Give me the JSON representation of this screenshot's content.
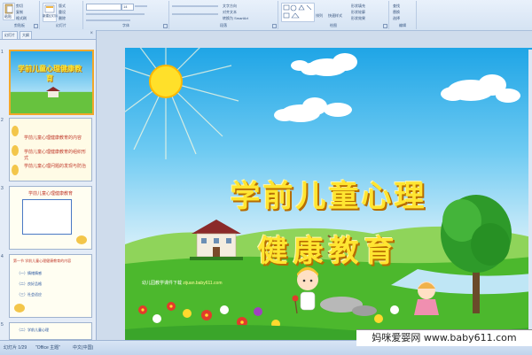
{
  "ribbon": {
    "groups": [
      {
        "label": "剪贴板"
      },
      {
        "label": "幻灯片"
      },
      {
        "label": "字体"
      },
      {
        "label": "段落"
      },
      {
        "label": "绘图"
      },
      {
        "label": "编辑"
      }
    ],
    "clipboard": {
      "paste": "粘贴",
      "cut": "剪切",
      "copy": "复制",
      "format": "格式刷"
    },
    "slides": {
      "new_slide": "新建幻灯片",
      "layout": "版式",
      "reset": "重设",
      "delete": "删除"
    },
    "font": {
      "size": "14"
    },
    "paragraph": {
      "text_direction": "文字方向",
      "align_text": "对齐文本",
      "smartart": "转换为 SmartArt"
    },
    "drawing": {
      "arrange": "排列",
      "quick_styles": "快速样式",
      "fill": "形状填充",
      "outline": "形状轮廓",
      "effects": "形状效果"
    },
    "editing": {
      "find": "查找",
      "replace": "替换",
      "select": "选择"
    }
  },
  "panel": {
    "tabs": [
      "幻灯片",
      "大纲"
    ],
    "thumbnails": [
      {
        "num": "1",
        "title": "学前儿童心理健康教育"
      },
      {
        "num": "2",
        "items": [
          "学前儿童心理健康教育的内容",
          "学前儿童心理健康教育的组织形式",
          "学前儿童心理问题的发现与防治"
        ]
      },
      {
        "num": "3",
        "heading": "学前儿童心理健康教育"
      },
      {
        "num": "4",
        "heading": "第一节 学前儿童心理健康教育的内容",
        "lines": [
          "（一）情绪情感",
          "（二）良好品格",
          "（三）社会适应"
        ]
      },
      {
        "num": "5",
        "heading": "（二）学前儿童心理"
      }
    ]
  },
  "slide": {
    "title_line1": "学前儿童心理",
    "title_line2": "健康教育",
    "credit": "幼儿园教学课件下载",
    "credit_url": "zijuan.baby611.com"
  },
  "status": {
    "slide_num": "幻灯片 1/29",
    "theme": "\"Office 主题\"",
    "lang": "中文(中国)"
  },
  "watermark": "妈咪爱婴网 www.baby611.com",
  "colors": {
    "sky": "#1fa5e6",
    "title": "#ffe531",
    "grass": "#4cb82d",
    "selection": "#f2a72a"
  }
}
